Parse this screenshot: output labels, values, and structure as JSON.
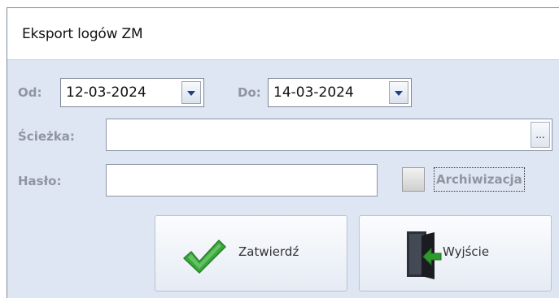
{
  "window": {
    "title": "Eksport logów ZM"
  },
  "form": {
    "od_label": "Od:",
    "od_value": "12-03-2024",
    "do_label": "Do:",
    "do_value": "14-03-2024",
    "sciezka_label": "Ścieżka:",
    "sciezka_value": "",
    "browse_label": "...",
    "haslo_label": "Hasło:",
    "haslo_value": "",
    "archiwizacja_label": "Archiwizacja",
    "archiwizacja_checked": false
  },
  "buttons": {
    "confirm_label": "Zatwierdź",
    "exit_label": "Wyjście"
  },
  "icons": {
    "confirm": "checkmark-icon",
    "exit": "exit-door-icon",
    "dropdown": "chevron-down-icon"
  },
  "colors": {
    "accent": "#1e3f80",
    "label": "#8f96a1",
    "check_green": "#3aa83a"
  }
}
